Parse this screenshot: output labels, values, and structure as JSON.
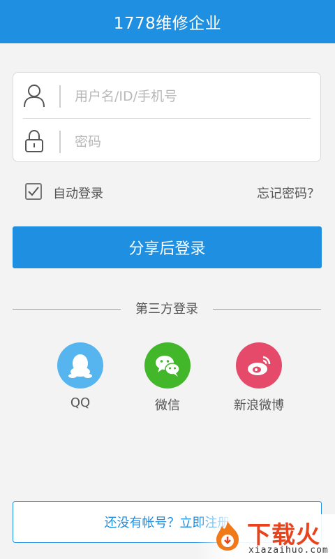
{
  "header": {
    "title": "1778维修企业"
  },
  "form": {
    "username_placeholder": "用户名/ID/手机号",
    "password_placeholder": "密码"
  },
  "options": {
    "auto_login_label": "自动登录",
    "auto_login_checked": true,
    "forgot_label": "忘记密码？"
  },
  "login_button": {
    "label": "分享后登录"
  },
  "third_party": {
    "heading": "第三方登录",
    "items": [
      {
        "label": "QQ",
        "icon": "qq-penguin-icon",
        "color": "#56b4ee"
      },
      {
        "label": "微信",
        "icon": "wechat-icon",
        "color": "#42b72a"
      },
      {
        "label": "新浪微博",
        "icon": "weibo-icon",
        "color": "#e64a6b"
      }
    ]
  },
  "register": {
    "label": "还没有帐号？立即注册"
  },
  "watermark": {
    "main": "下载火",
    "sub": "xiazaihuo.com"
  },
  "colors": {
    "primary": "#1e8fe1",
    "background": "#f3f3f3"
  }
}
